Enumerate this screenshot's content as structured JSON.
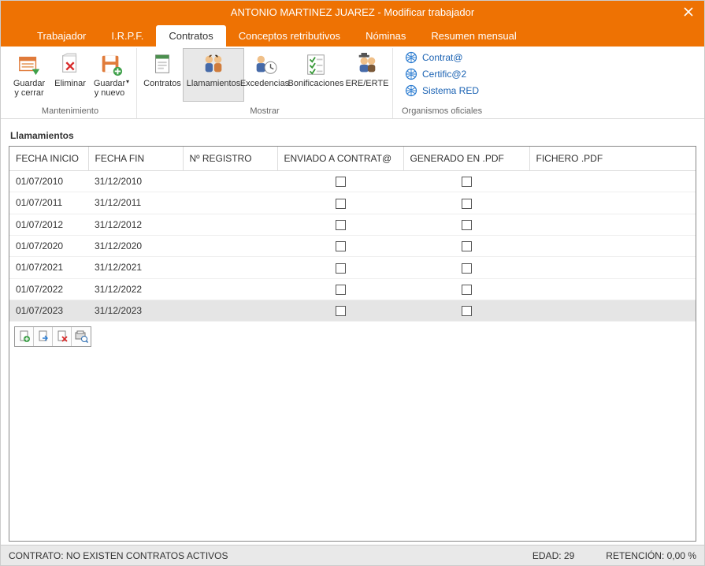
{
  "window": {
    "title": "ANTONIO MARTINEZ JUAREZ - Modificar trabajador"
  },
  "tabs": [
    {
      "label": "Trabajador",
      "active": false
    },
    {
      "label": "I.R.P.F.",
      "active": false
    },
    {
      "label": "Contratos",
      "active": true
    },
    {
      "label": "Conceptos retributivos",
      "active": false
    },
    {
      "label": "Nóminas",
      "active": false
    },
    {
      "label": "Resumen mensual",
      "active": false
    }
  ],
  "ribbon": {
    "groups": {
      "mantenimiento": {
        "label": "Mantenimiento",
        "buttons": {
          "guardar_cerrar": "Guardar y cerrar",
          "eliminar": "Eliminar",
          "guardar_nuevo": "Guardar y nuevo"
        }
      },
      "mostrar": {
        "label": "Mostrar",
        "buttons": {
          "contratos": "Contratos",
          "llamamientos": "Llamamientos",
          "excedencias": "Excedencias",
          "bonificaciones": "Bonificaciones",
          "ere_erte": "ERE/ERTE"
        }
      },
      "organismos": {
        "label": "Organismos oficiales",
        "links": {
          "contrata": "Contrat@",
          "certifica2": "Certific@2",
          "sistema_red": "Sistema RED"
        }
      }
    }
  },
  "section_title": "Llamamientos",
  "table": {
    "columns": [
      "FECHA INICIO",
      "FECHA FIN",
      "Nº REGISTRO",
      "ENVIADO A CONTRAT@",
      "GENERADO EN .PDF",
      "FICHERO .PDF"
    ],
    "rows": [
      {
        "inicio": "01/07/2010",
        "fin": "31/12/2010",
        "registro": "",
        "enviado": false,
        "generado": false,
        "fichero": ""
      },
      {
        "inicio": "01/07/2011",
        "fin": "31/12/2011",
        "registro": "",
        "enviado": false,
        "generado": false,
        "fichero": ""
      },
      {
        "inicio": "01/07/2012",
        "fin": "31/12/2012",
        "registro": "",
        "enviado": false,
        "generado": false,
        "fichero": ""
      },
      {
        "inicio": "01/07/2020",
        "fin": "31/12/2020",
        "registro": "",
        "enviado": false,
        "generado": false,
        "fichero": ""
      },
      {
        "inicio": "01/07/2021",
        "fin": "31/12/2021",
        "registro": "",
        "enviado": false,
        "generado": false,
        "fichero": ""
      },
      {
        "inicio": "01/07/2022",
        "fin": "31/12/2022",
        "registro": "",
        "enviado": false,
        "generado": false,
        "fichero": ""
      },
      {
        "inicio": "01/07/2023",
        "fin": "31/12/2023",
        "registro": "",
        "enviado": false,
        "generado": false,
        "fichero": "",
        "selected": true
      }
    ]
  },
  "statusbar": {
    "contrato_label": "CONTRATO:",
    "contrato_value": "NO EXISTEN CONTRATOS ACTIVOS",
    "edad_label": "EDAD:",
    "edad_value": "29",
    "retencion_label": "RETENCIÓN:",
    "retencion_value": "0,00 %"
  },
  "colors": {
    "accent": "#ee7203",
    "link": "#1a62b3"
  }
}
